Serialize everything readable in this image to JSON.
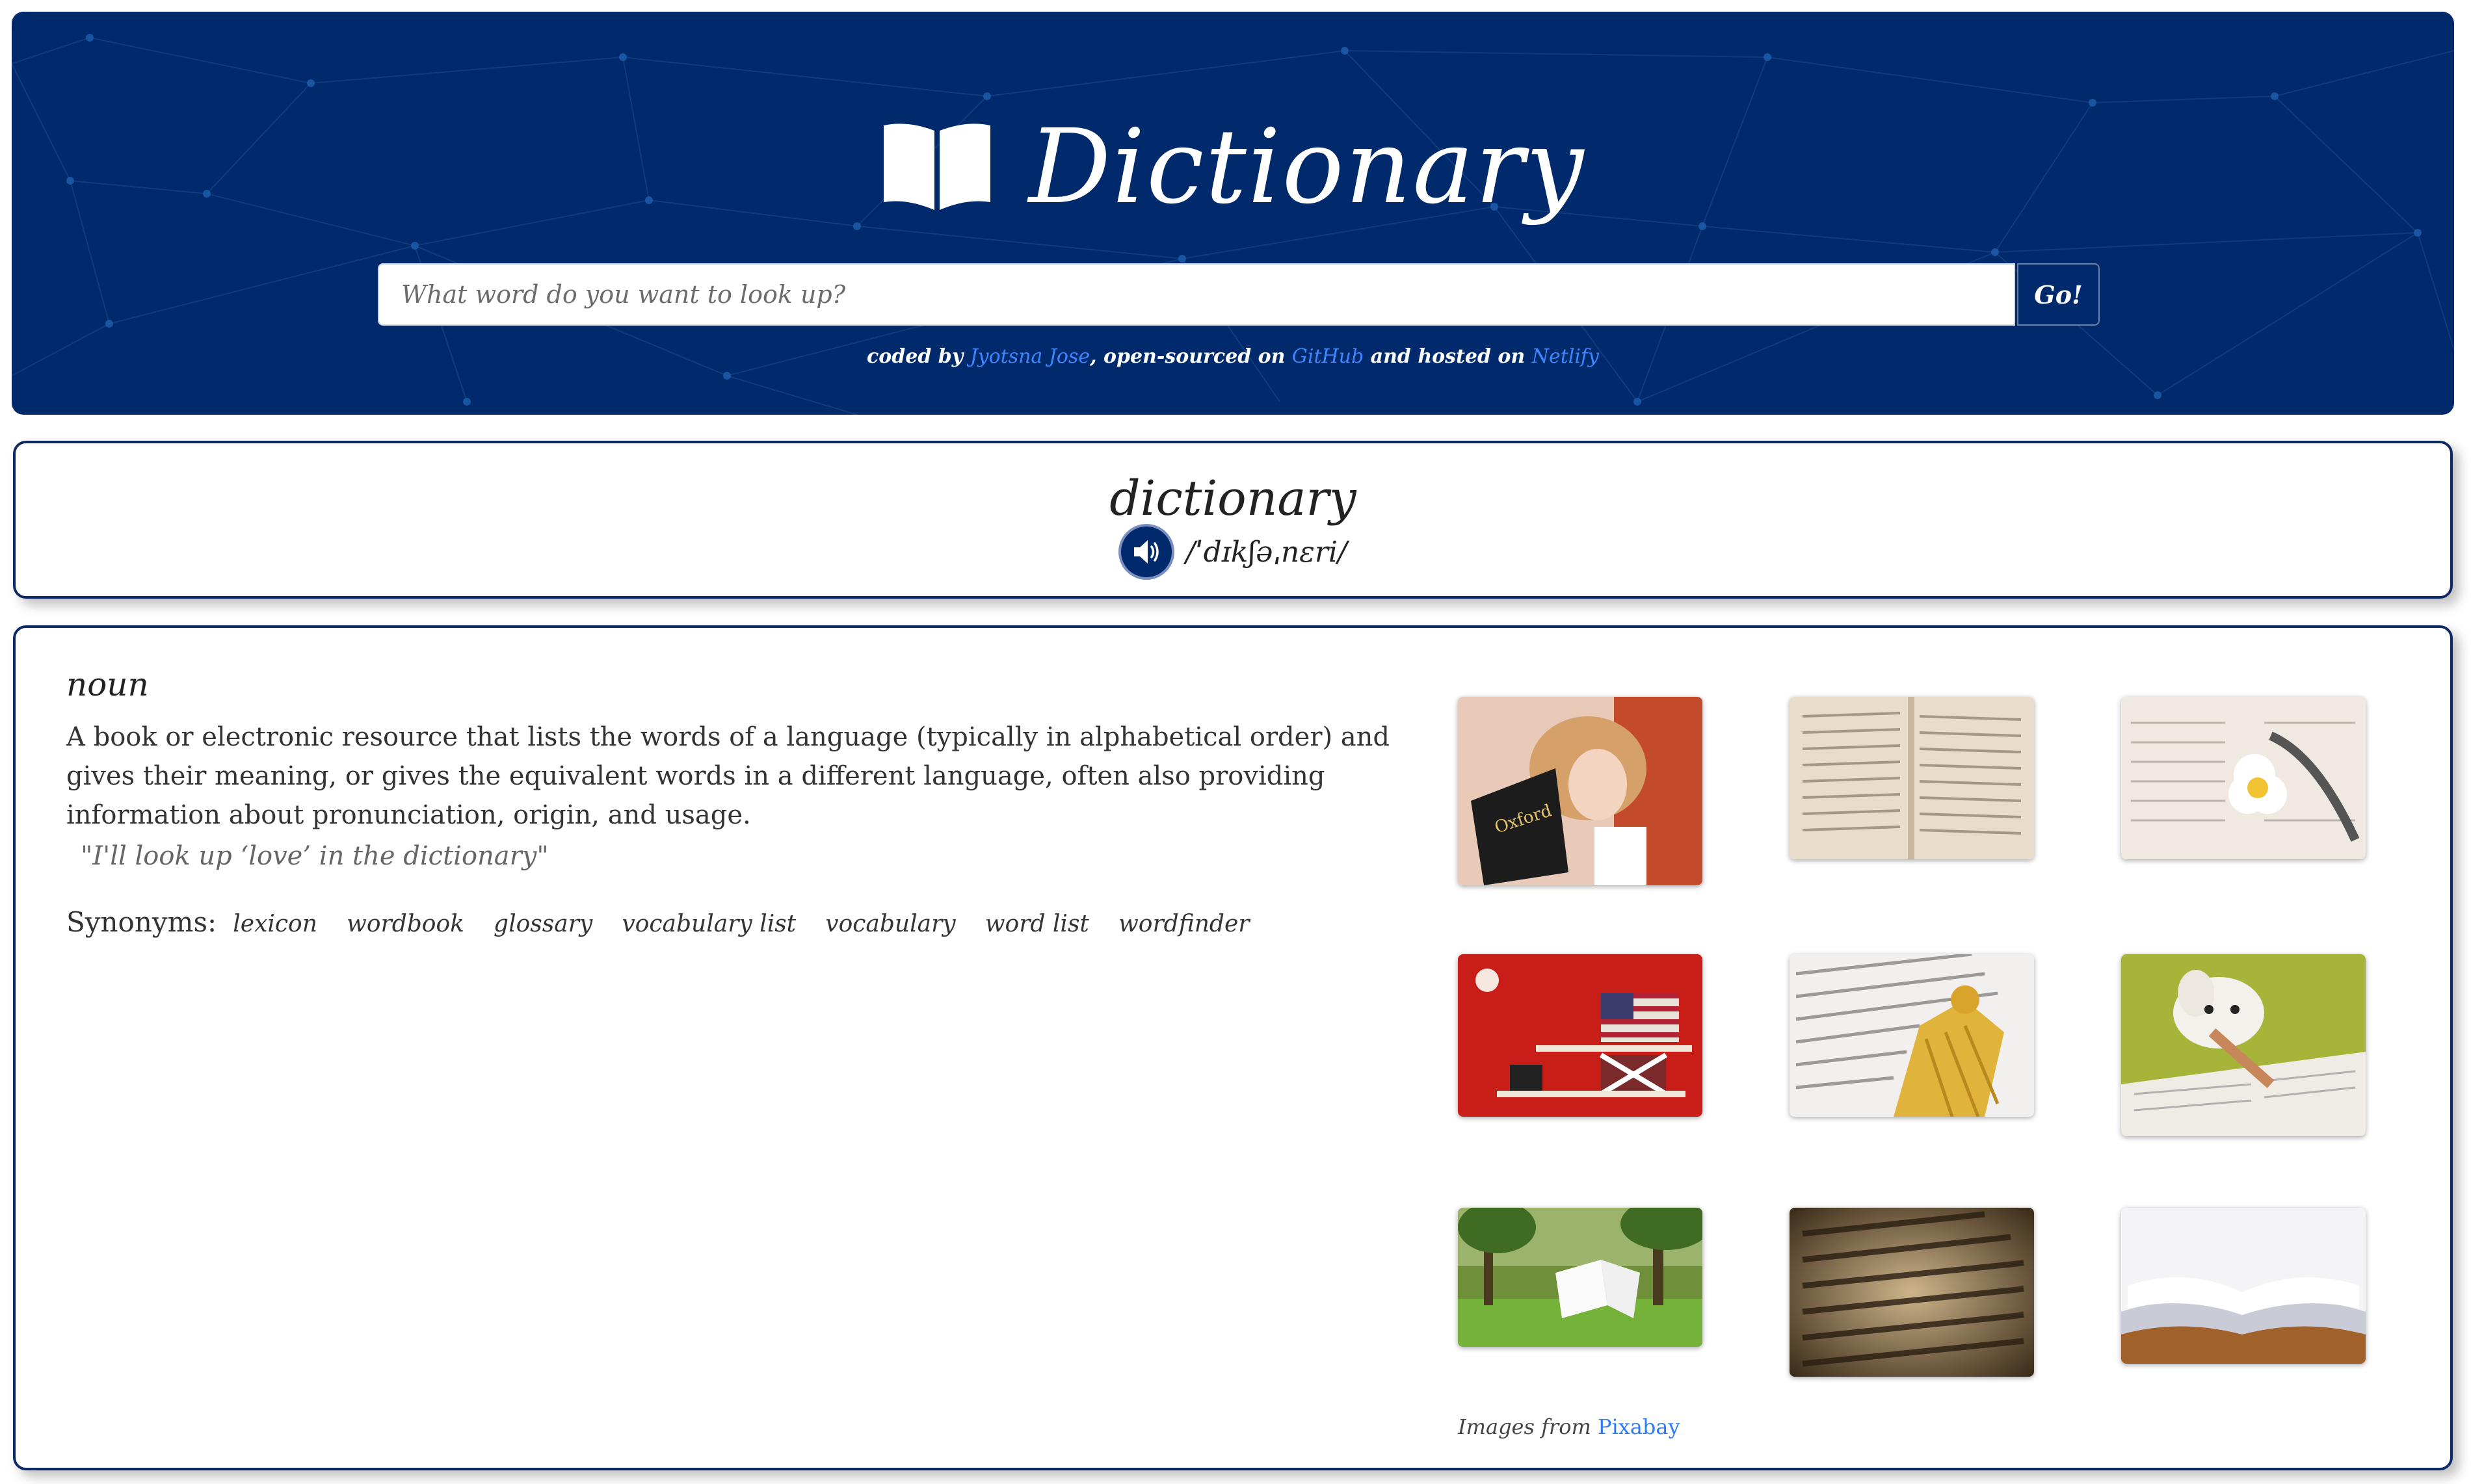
{
  "header": {
    "title": "Dictionary",
    "search": {
      "placeholder": "What word do you want to look up?",
      "value": ""
    },
    "go_label": "Go!",
    "credits": {
      "coded_by": "coded by",
      "author": "Jyotsna Jose",
      "open_sourced_on": ", open-sourced on",
      "github": "GitHub",
      "hosted_on": "and hosted on",
      "netlify": "Netlify"
    },
    "background_color": "#012a6c"
  },
  "word": {
    "text": "dictionary",
    "phonetic": "/ˈdɪkʃəˌnɛri/"
  },
  "meaning": {
    "part_of_speech": "noun",
    "definition": "A book or electronic resource that lists the words of a language (typically in alphabetical order) and gives their meaning, or gives the equivalent words in a different language, often also providing information about pronunciation, origin, and usage.",
    "example": "\"I'll look up ‘love’ in the dictionary\"",
    "synonyms_label": "Synonyms:",
    "synonyms": [
      "lexicon",
      "wordbook",
      "glossary",
      "vocabulary list",
      "vocabulary",
      "word list",
      "wordfinder"
    ]
  },
  "images": {
    "credit_prefix": "Images from",
    "credit_link": "Pixabay",
    "thumbnails": [
      "girl-reading-dictionary",
      "dictionary-pages",
      "daisy-on-dictionary",
      "shelf-with-flags",
      "dictionary-with-tassel",
      "toy-dog-on-book",
      "book-in-park",
      "dictionary-closeup-collaborate",
      "open-book-on-table"
    ]
  }
}
